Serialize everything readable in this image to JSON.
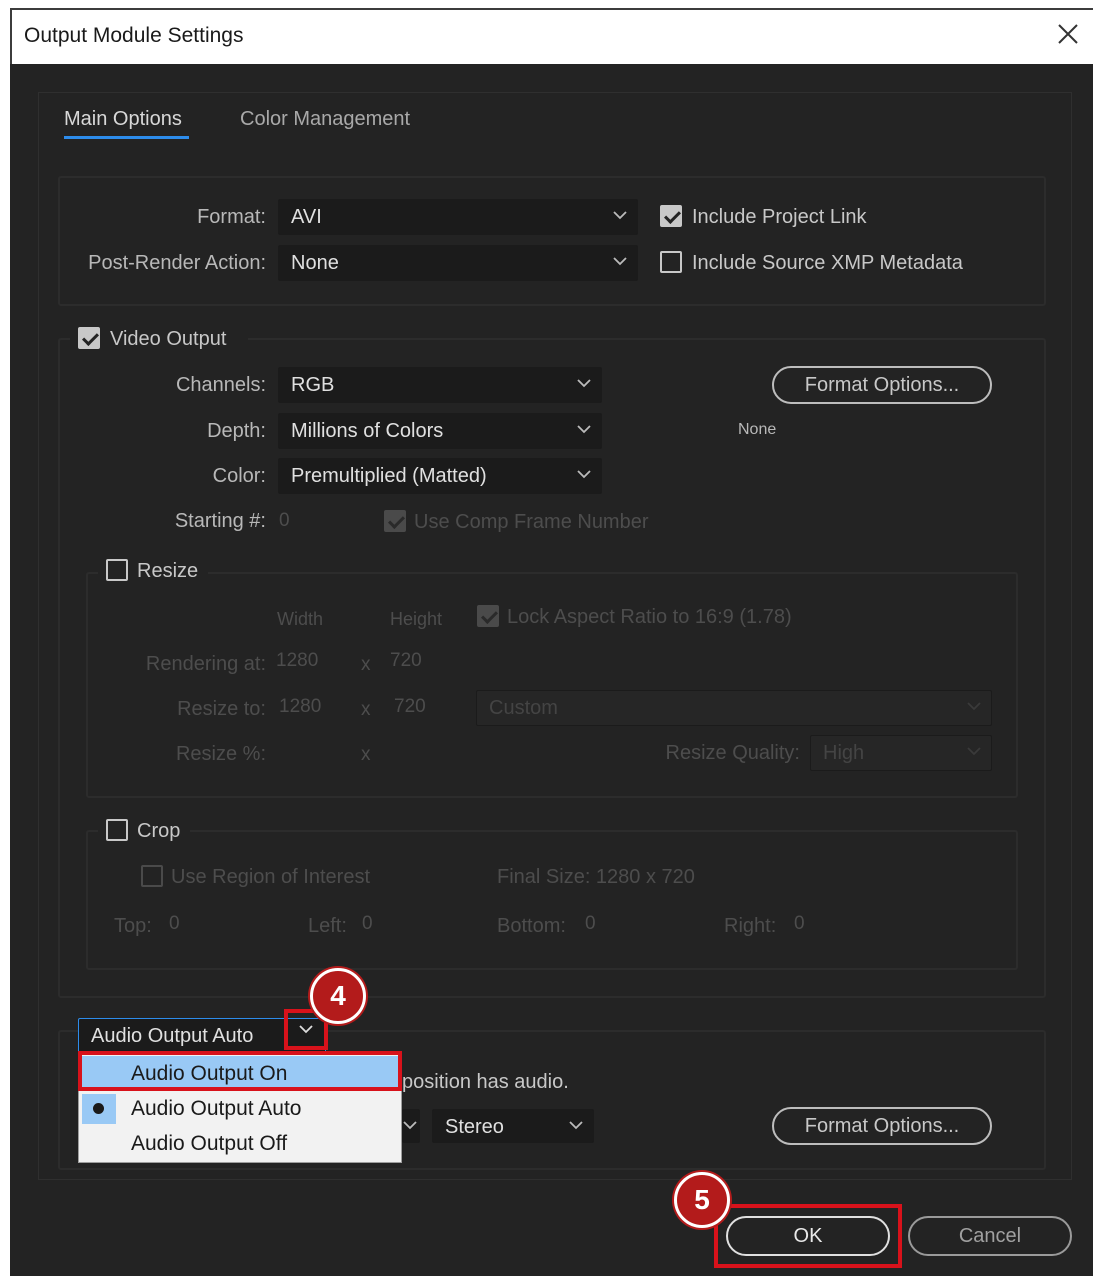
{
  "window": {
    "title": "Output Module Settings"
  },
  "tabs": [
    {
      "label": "Main Options",
      "active": true
    },
    {
      "label": "Color Management",
      "active": false
    }
  ],
  "top_group": {
    "format_label": "Format:",
    "format_value": "AVI",
    "post_render_label": "Post-Render Action:",
    "post_render_value": "None",
    "include_project_link": {
      "label": "Include Project Link",
      "checked": true
    },
    "include_xmp": {
      "label": "Include Source XMP Metadata",
      "checked": false
    }
  },
  "video": {
    "label": "Video Output",
    "checked": true,
    "channels_label": "Channels:",
    "channels_value": "RGB",
    "depth_label": "Depth:",
    "depth_value": "Millions of Colors",
    "color_label": "Color:",
    "color_value": "Premultiplied (Matted)",
    "starting_label": "Starting #:",
    "starting_value": "0",
    "use_comp_frame": {
      "label": "Use Comp Frame Number",
      "checked": true
    },
    "format_options_label": "Format Options...",
    "format_note": "None"
  },
  "resize": {
    "label": "Resize",
    "checked": false,
    "width_header": "Width",
    "height_header": "Height",
    "lock_aspect": {
      "label": "Lock Aspect Ratio to 16:9 (1.78)",
      "checked": true
    },
    "rendering_label": "Rendering at:",
    "rendering_w": "1280",
    "rendering_h": "720",
    "resize_to_label": "Resize to:",
    "resize_to_w": "1280",
    "resize_to_h": "720",
    "preset_value": "Custom",
    "resize_pct_label": "Resize %:",
    "x_sep": "x",
    "quality_label": "Resize Quality:",
    "quality_value": "High"
  },
  "crop": {
    "label": "Crop",
    "checked": false,
    "use_roi": {
      "label": "Use Region of Interest",
      "checked": false
    },
    "final_size": "Final Size: 1280 x 720",
    "top_label": "Top:",
    "top_value": "0",
    "left_label": "Left:",
    "left_value": "0",
    "bottom_label": "Bottom:",
    "bottom_value": "0",
    "right_label": "Right:",
    "right_value": "0"
  },
  "audio": {
    "dropdown_value": "Audio Output Auto",
    "hint_fragment": "position has audio.",
    "channels_value": "Stereo",
    "format_options_label": "Format Options...",
    "menu_items": [
      {
        "label": "Audio Output On",
        "selected": false,
        "highlighted": true
      },
      {
        "label": "Audio Output Auto",
        "selected": true,
        "highlighted": false
      },
      {
        "label": "Audio Output Off",
        "selected": false,
        "highlighted": false
      }
    ]
  },
  "buttons": {
    "ok": "OK",
    "cancel": "Cancel"
  },
  "annotations": {
    "step4": "4",
    "step5": "5"
  },
  "colors": {
    "accent": "#2d8ceb",
    "annotation_red": "#d8121b",
    "menu_highlight": "#99c9f5"
  }
}
